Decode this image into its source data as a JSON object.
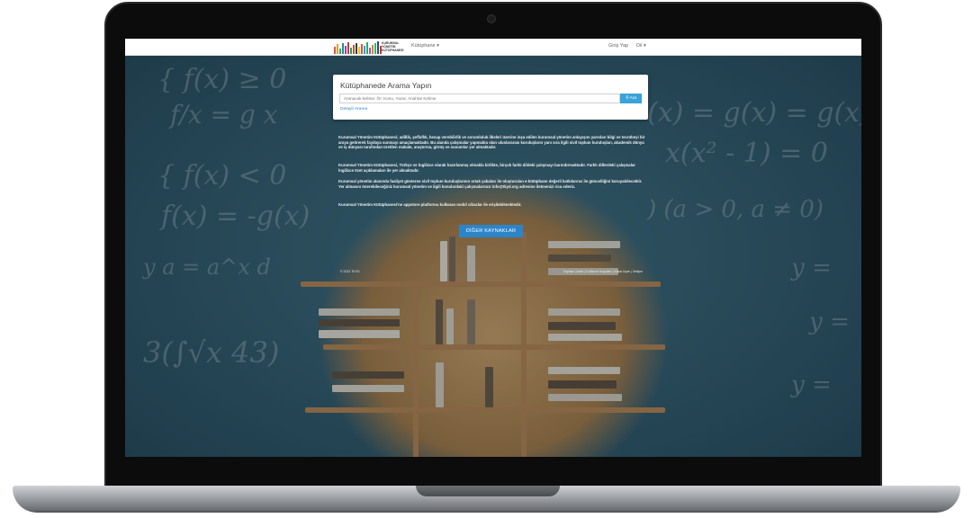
{
  "navbar": {
    "logo_text": "KURUMSAL\nYÖNETİM\nKÜTÜPHANESİ",
    "library_menu": "Kütüphane ▾",
    "login": "Giriş Yap",
    "language": "Dil ▾"
  },
  "search": {
    "title": "Kütüphanede Arama Yapın",
    "placeholder": "Aranacak kelime: Ör: Konu, Yazar, Anahtar Kelime",
    "button": "Ara",
    "advanced_link": "Detaylı Arama"
  },
  "about": {
    "p1": "Kurumsal Yönetim Kütüphanesi; adillik, şeffaflık, hesap verebilirlik ve sorumluluk ilkeleri üzerine inşa edilen kurumsal yönetim anlayışını yarınları bilgi ve tecrübeyi bir araya getirerek faydaya sunmayı amaçlamaktadır. Bu alanda çalışmalar yapmakta olan uluslararası kuruluşların yanı sıra ilgili sivil toplum kuruluşları, akademik dünya ve iş dünyası tarafından üretilen makale, araştırma, görüş ve sunumlar yer almaktadır.",
    "p2": "Kurumsal Yönetim Kütüphanesi, Türkçe ve İngilizce olarak hazırlanmış olmakla birlikte, birçok farklı dildeki çalışmayı barındırmaktadır. Farklı dillerdeki çalışmalar İngilizce özet açıklamaları ile yer almaktadır.",
    "p3": "Kurumsal yönetim alanında faaliyet gösteren sivil toplum kuruluşlarının ortak çabaları ile oluşturulan e-kütüphane değerli katkılarınız ile güncelliğini koruyabilecektir. Yer almasını önerebileceğiniz kurumsal yönetim ve ilgili konulardaki çalışmalarınızı info@tkyd.org adresine iletmenizi rica ederiz.",
    "p4": "Kurumsal Yönetim Kütüphanesi'ne appstore platformu kullanan mobil cihazlar ile erişilebilmektedir."
  },
  "cta_button": "DİĞER KAYNAKLAR",
  "footer": {
    "copyright": "© 2021 TKYD",
    "links": "Faydalı Linkler | Kullanım Koşulları | Yasal Uyarı | İletişim"
  },
  "colors": {
    "accent_button": "#38a3d8",
    "cta_button": "#2c84c9",
    "link": "#2f86c5",
    "background_board": "#2d5466"
  },
  "icons": {
    "search": "search-icon"
  }
}
